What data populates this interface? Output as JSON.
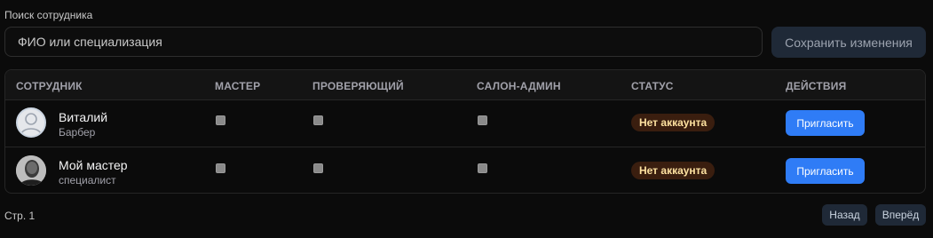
{
  "search": {
    "label": "Поиск сотрудника",
    "placeholder": "ФИО или специализация",
    "value": ""
  },
  "save_button": "Сохранить изменения",
  "table": {
    "columns": [
      "СОТРУДНИК",
      "МАСТЕР",
      "ПРОВЕРЯЮЩИЙ",
      "САЛОН-АДМИН",
      "СТАТУС",
      "ДЕЙСТВИЯ"
    ],
    "rows": [
      {
        "name": "Виталий",
        "role": "Барбер",
        "avatar": "default-user-icon",
        "master": false,
        "reviewer": false,
        "salon_admin": false,
        "status": "Нет аккаунта",
        "action": "Пригласить"
      },
      {
        "name": "Мой мастер",
        "role": "специалист",
        "avatar": "photo-avatar",
        "master": false,
        "reviewer": false,
        "salon_admin": false,
        "status": "Нет аккаунта",
        "action": "Пригласить"
      }
    ]
  },
  "pagination": {
    "page_label": "Стр. 1",
    "prev": "Назад",
    "next": "Вперёд"
  },
  "colors": {
    "accent": "#2f7cf6",
    "badge_bg": "#3a1e0f",
    "badge_text": "#fde1a0"
  }
}
